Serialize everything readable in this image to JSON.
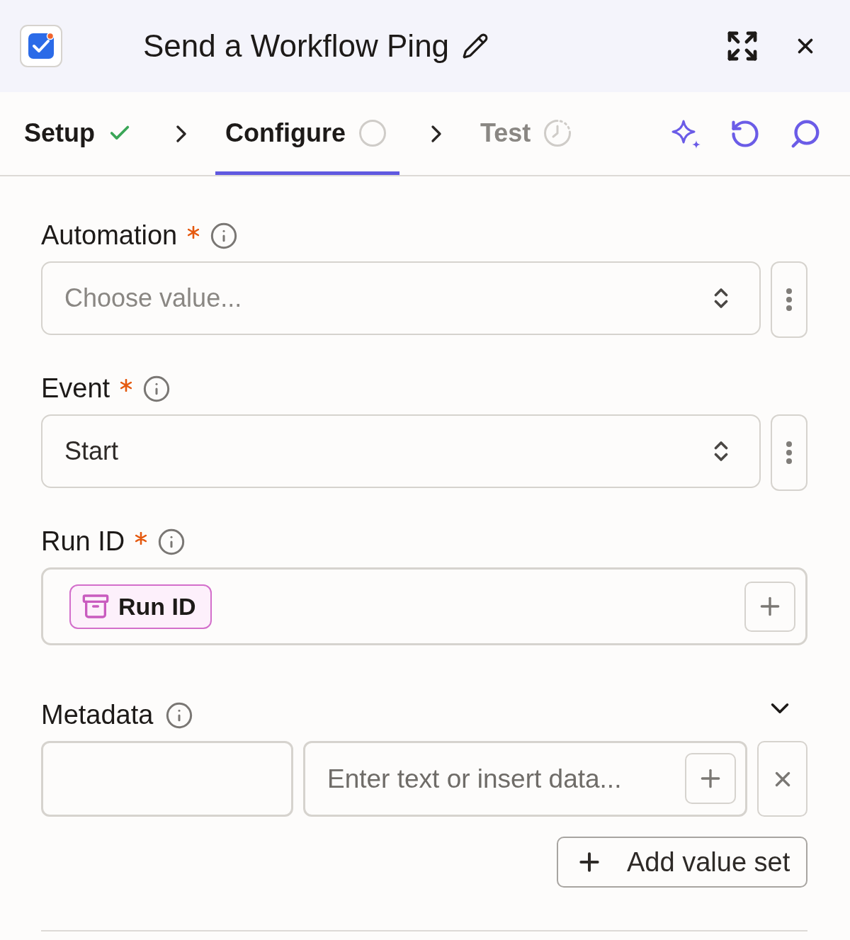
{
  "header": {
    "title": "Send a Workflow Ping"
  },
  "steps": [
    {
      "label": "Setup",
      "kind": "done",
      "selected": false,
      "disabled": false
    },
    {
      "label": "Configure",
      "kind": "open",
      "selected": true,
      "disabled": false
    },
    {
      "label": "Test",
      "kind": "timed",
      "selected": false,
      "disabled": true
    }
  ],
  "fields": [
    {
      "kind": "select",
      "label": "Automation",
      "required": true,
      "placeholder": "Choose value..."
    },
    {
      "kind": "select",
      "label": "Event",
      "required": true,
      "value": "Start"
    },
    {
      "kind": "tokens",
      "label": "Run ID",
      "required": true,
      "tokens": [
        "Run ID"
      ]
    }
  ],
  "metadata": {
    "label": "Metadata",
    "expanded": true,
    "rows": [
      {
        "value": {
          "placeholder": "Enter text or insert data..."
        }
      }
    ],
    "add_button": "Add value set"
  }
}
